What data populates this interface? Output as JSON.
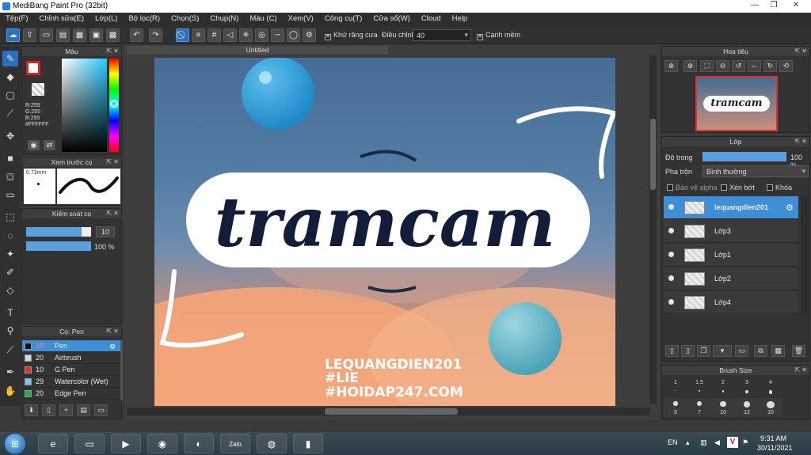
{
  "window": {
    "title": "MediBang Paint Pro (32bit)"
  },
  "menu": [
    "Tệp(F)",
    "Chỉnh sửa(E)",
    "Lớp(L)",
    "Bộ lọc(R)",
    "Chọn(S)",
    "Chụp(N)",
    "Màu (C)",
    "Xem(V)",
    "Công cụ(T)",
    "Cửa sổ(W)",
    "Cloud",
    "Help"
  ],
  "toolbar": {
    "antialias_label": "Khử răng cưa",
    "adjust_label": "Điều chỉnh",
    "adjust_value": "40",
    "smooth_label": "Cạnh mềm"
  },
  "color_panel": {
    "title": "Màu",
    "r": "R:255",
    "g": "G:255",
    "b": "B:255",
    "hex": "#FFFFFF"
  },
  "brush_preview": {
    "title": "Xem trước cọ",
    "size": "0.73mm"
  },
  "brush_control": {
    "title": "Kiểm soát cọ",
    "size_value": "10",
    "opacity_value": "100 %",
    "size_fill": 0.85,
    "opacity_fill": 1.0
  },
  "brush_panel": {
    "title": "Cọ: Pen",
    "items": [
      {
        "size": "10",
        "name": "Pen",
        "color": "#111111",
        "active": true
      },
      {
        "size": "20",
        "name": "Airbrush",
        "color": "#d8d8d8",
        "active": false
      },
      {
        "size": "10",
        "name": "G Pen",
        "color": "#e03030",
        "active": false
      },
      {
        "size": "29",
        "name": "Watercolor (Wet)",
        "color": "#7fc4ef",
        "active": false
      },
      {
        "size": "20",
        "name": "Edge Pen",
        "color": "#20b040",
        "active": false
      }
    ]
  },
  "document": {
    "tab": "Untitled"
  },
  "artwork": {
    "title": "tramcam",
    "credits": [
      "LEQUANGDIEN201",
      "#LIE",
      "#HOIDAP247.COM"
    ]
  },
  "navigator": {
    "title": "Hoa tiêu"
  },
  "layer_panel": {
    "title": "Lớp",
    "opacity_label": "Độ trong",
    "opacity_value": "100 %",
    "opacity_fill": 1.0,
    "blend_label": "Pha trộn",
    "blend_value": "Bình thường",
    "protect_alpha": "Bảo vệ alpha",
    "clipping": "Xén bớt",
    "lock": "Khóa",
    "layers": [
      {
        "name": "lequangdien201",
        "active": true
      },
      {
        "name": "Lớp3",
        "active": false
      },
      {
        "name": "Lớp1",
        "active": false
      },
      {
        "name": "Lớp2",
        "active": false
      },
      {
        "name": "Lớp4",
        "active": false
      }
    ]
  },
  "brush_size": {
    "title": "Brush Size",
    "sizes": [
      "1",
      "1.5",
      "2",
      "3",
      "4",
      "5",
      "7",
      "10",
      "12",
      "15"
    ]
  },
  "taskbar": {
    "lang": "EN",
    "time": "9:31 AM",
    "date": "30/11/2021"
  },
  "colors": {
    "accent": "#3f8fd6",
    "primary_color": "#e02020"
  }
}
